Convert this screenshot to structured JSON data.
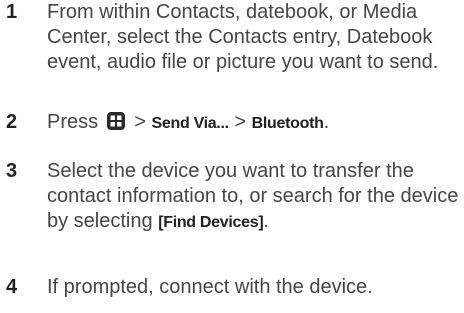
{
  "steps": [
    {
      "number": "1",
      "text": "From within Contacts, datebook, or Media Center, select the Contacts entry, Datebook event, audio file or picture you want to send."
    },
    {
      "number": "2",
      "prefix": "Press",
      "icon": "menu-key-icon",
      "sep1": ">",
      "cmd1": "Send Via...",
      "sep2": ">",
      "cmd2": "Bluetooth",
      "suffix": "."
    },
    {
      "number": "3",
      "text": "Select the device you want to transfer the contact information to, or search for the device by selecting",
      "cmd": "[Find Devices]",
      "suffix": "."
    },
    {
      "number": "4",
      "text": "If prompted, connect with the device."
    }
  ]
}
